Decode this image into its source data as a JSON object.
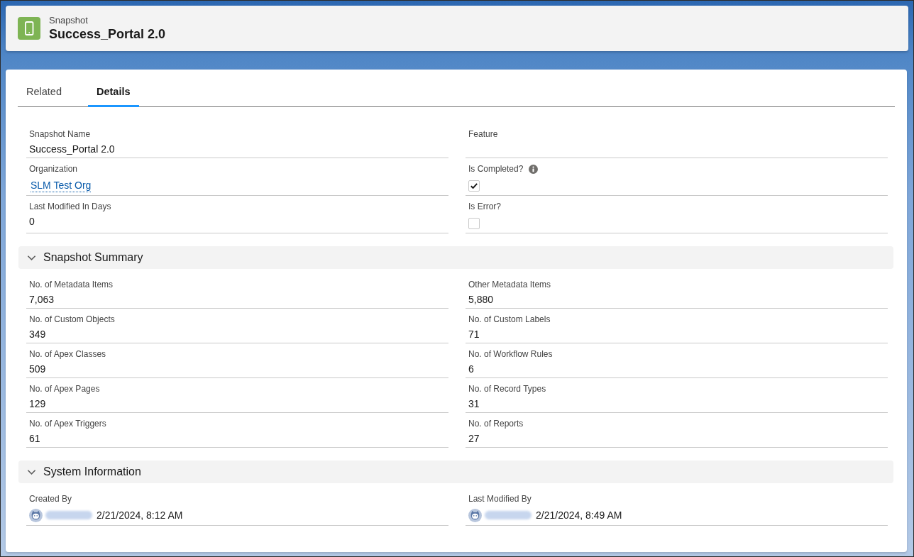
{
  "header": {
    "object_type": "Snapshot",
    "title": "Success_Portal 2.0"
  },
  "tabs": [
    {
      "label": "Related",
      "selected": false
    },
    {
      "label": "Details",
      "selected": true
    }
  ],
  "fields": [
    {
      "label": "Snapshot Name",
      "kind": "text",
      "value": "Success_Portal 2.0"
    },
    {
      "label": "Feature",
      "kind": "text"
    },
    {
      "label": "Organization",
      "kind": "link",
      "value": "SLM Test Org"
    },
    {
      "label": "Is Completed?",
      "kind": "checkbox",
      "help_icon": true,
      "checked": true
    },
    {
      "label": "Last Modified In Days",
      "kind": "text",
      "value": "0"
    },
    {
      "label": "Is Error?",
      "kind": "checkbox",
      "checked": false
    }
  ],
  "sections": [
    {
      "title": "Snapshot Summary",
      "expanded": true,
      "fields": [
        {
          "label": "No. of Metadata Items",
          "kind": "text",
          "value": "7,063"
        },
        {
          "label": "Other Metadata Items",
          "kind": "text",
          "value": "5,880"
        },
        {
          "label": "No. of Custom Objects",
          "kind": "text",
          "value": "349"
        },
        {
          "label": "No. of Custom Labels",
          "kind": "text",
          "value": "71"
        },
        {
          "label": "No. of Apex Classes",
          "kind": "text",
          "value": "509"
        },
        {
          "label": "No. of Workflow Rules",
          "kind": "text",
          "value": "6"
        },
        {
          "label": "No. of Apex Pages",
          "kind": "text",
          "value": "129"
        },
        {
          "label": "No. of Record Types",
          "kind": "text",
          "value": "31"
        },
        {
          "label": "No. of Apex Triggers",
          "kind": "text",
          "value": "61"
        },
        {
          "label": "No. of Reports",
          "kind": "text",
          "value": "27"
        }
      ]
    },
    {
      "title": "System Information",
      "expanded": true,
      "fields": [
        {
          "label": "Created By",
          "kind": "user",
          "value": "2/21/2024, 8:12 AM"
        },
        {
          "label": "Last Modified By",
          "kind": "user",
          "value": "2/21/2024, 8:49 AM"
        }
      ]
    }
  ]
}
